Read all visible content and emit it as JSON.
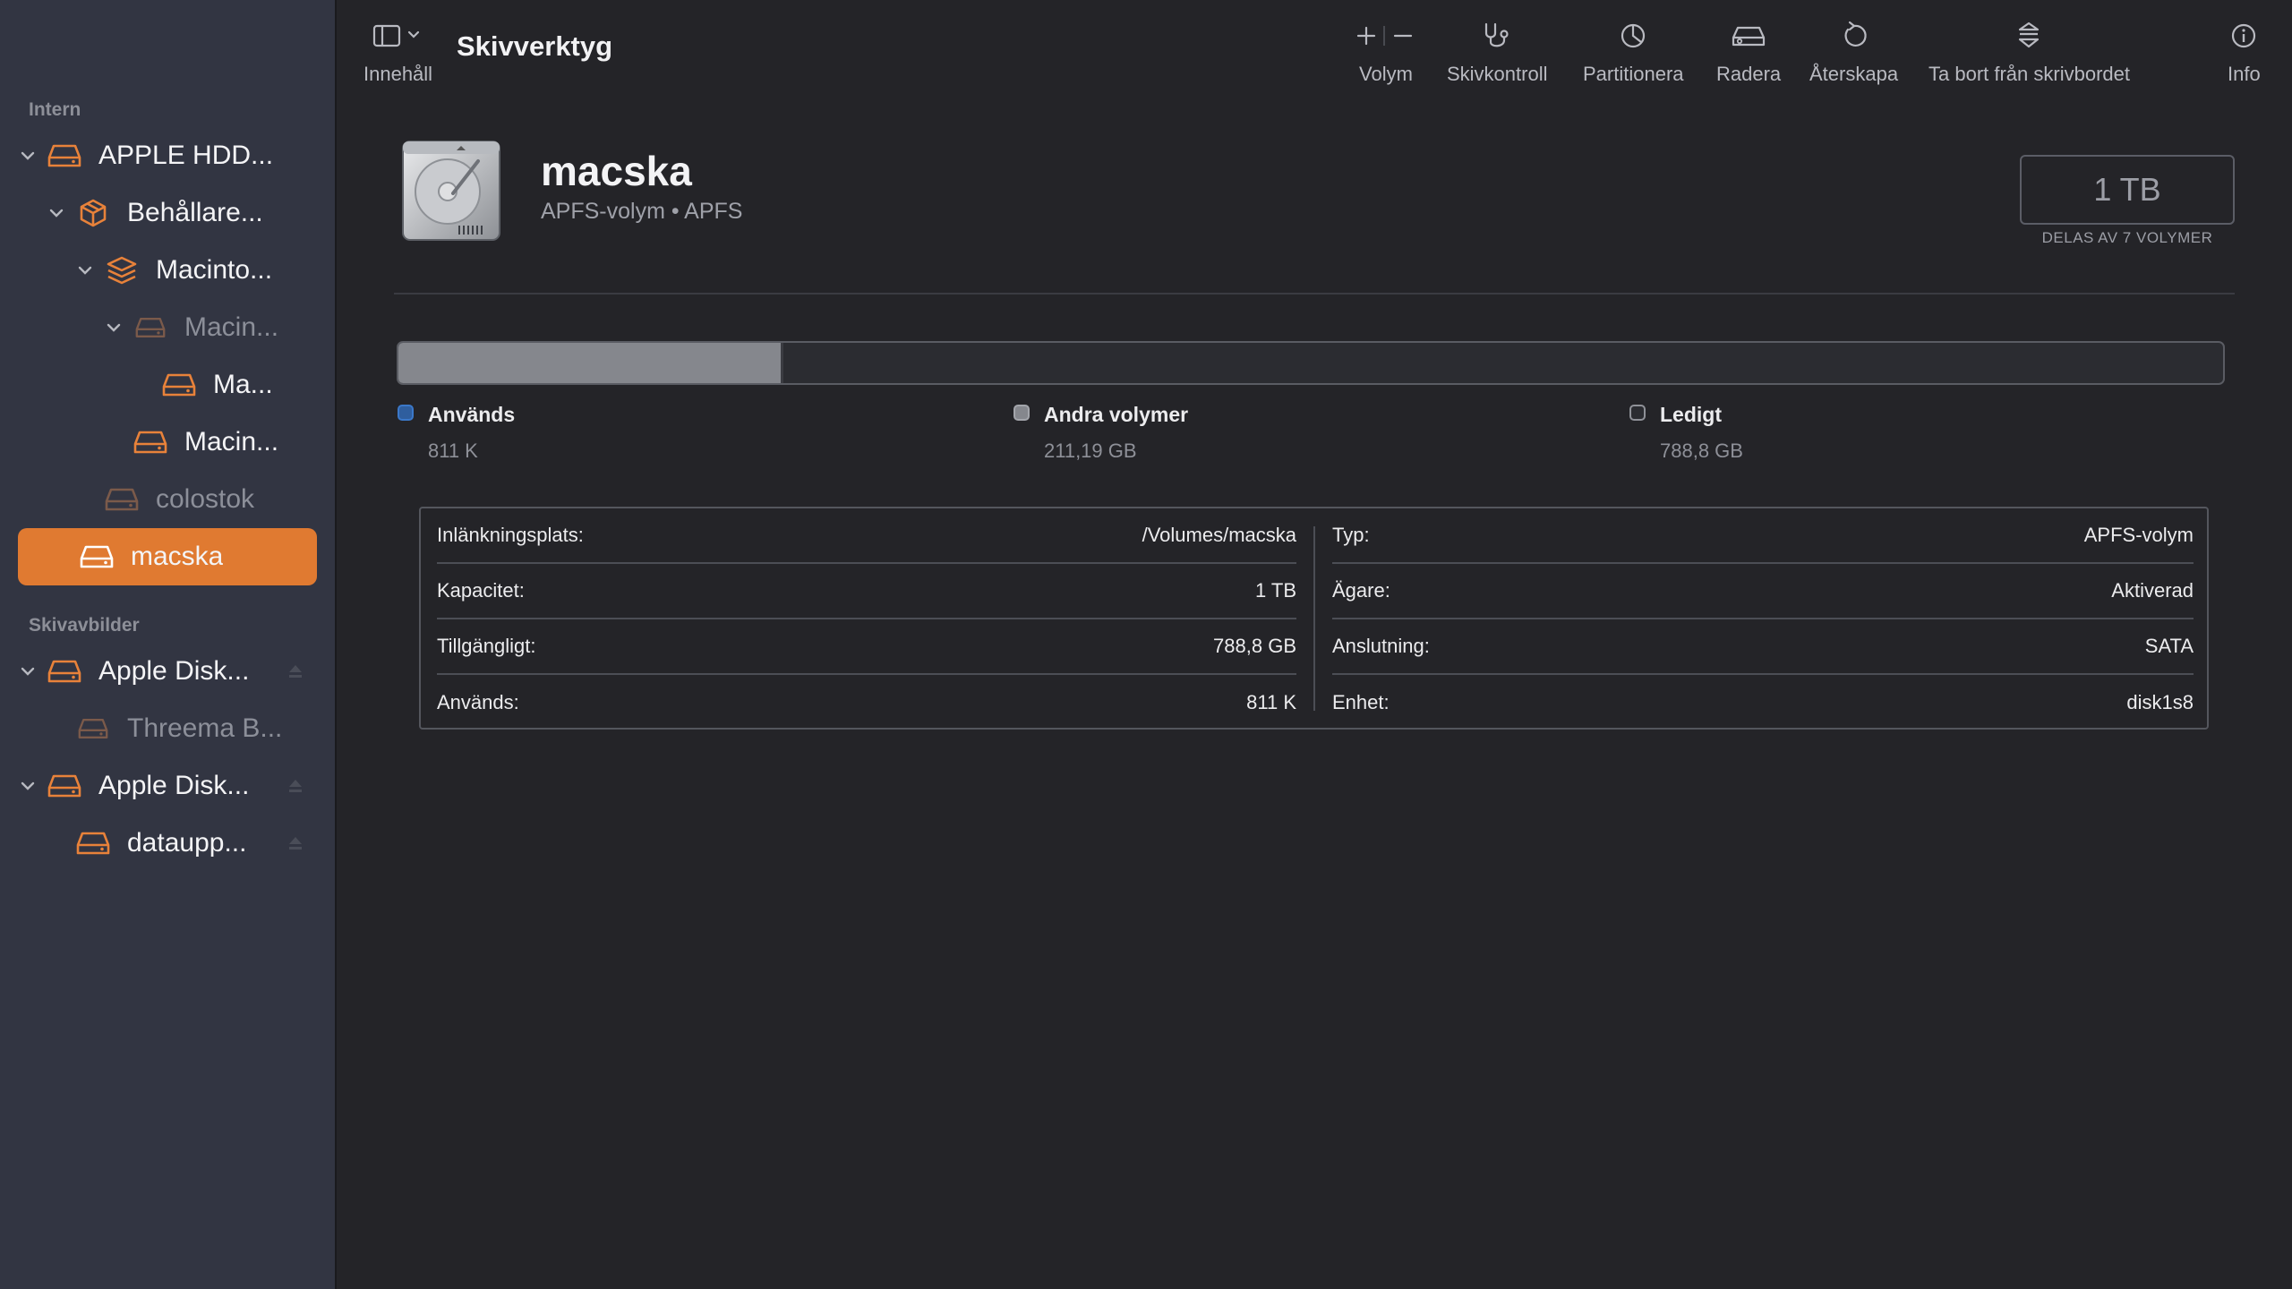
{
  "sidebar": {
    "sections": [
      {
        "label": "Intern"
      },
      {
        "label": "Skivavbilder"
      }
    ],
    "items": [
      {
        "label": "APPLE HDD...",
        "icon": "hard-drive-icon"
      },
      {
        "label": "Behållare...",
        "icon": "container-icon"
      },
      {
        "label": "Macinto...",
        "icon": "volume-group-icon"
      },
      {
        "label": "Macin...",
        "icon": "hard-drive-icon"
      },
      {
        "label": "Ma...",
        "icon": "hard-drive-icon"
      },
      {
        "label": "Macin...",
        "icon": "hard-drive-icon"
      },
      {
        "label": "colostok",
        "icon": "hard-drive-icon"
      },
      {
        "label": "macska",
        "icon": "hard-drive-icon",
        "selected": true
      },
      {
        "label": "Apple Disk...",
        "icon": "hard-drive-icon"
      },
      {
        "label": "Threema B...",
        "icon": "hard-drive-icon"
      },
      {
        "label": "Apple Disk...",
        "icon": "hard-drive-icon"
      },
      {
        "label": "dataupp...",
        "icon": "hard-drive-icon"
      }
    ]
  },
  "toolbar": {
    "sidebar_toggle_label": "Innehåll",
    "title": "Skivverktyg",
    "buttons": {
      "volume": "Volym",
      "first_aid": "Skivkontroll",
      "partition": "Partitionera",
      "erase": "Radera",
      "restore": "Återskapa",
      "unmount": "Ta bort från skrivbordet",
      "info": "Info"
    }
  },
  "volume": {
    "name": "macska",
    "subtitle": "APFS-volym • APFS",
    "capacity": "1 TB",
    "capacity_note": "DELAS AV 7 VOLYMER"
  },
  "usage": {
    "other_fraction": 0.211,
    "legend": [
      {
        "label": "Används",
        "value": "811 K",
        "color": "#3b78c9"
      },
      {
        "label": "Andra volymer",
        "value": "211,19 GB",
        "color": "#85878d"
      },
      {
        "label": "Ledigt",
        "value": "788,8 GB",
        "color": "#2b2c31"
      }
    ]
  },
  "info": {
    "left": [
      {
        "key": "Inlänkningsplats:",
        "value": "/Volumes/macska"
      },
      {
        "key": "Kapacitet:",
        "value": "1 TB"
      },
      {
        "key": "Tillgängligt:",
        "value": "788,8 GB"
      },
      {
        "key": "Används:",
        "value": "811 K"
      }
    ],
    "right": [
      {
        "key": "Typ:",
        "value": "APFS-volym"
      },
      {
        "key": "Ägare:",
        "value": "Aktiverad"
      },
      {
        "key": "Anslutning:",
        "value": "SATA"
      },
      {
        "key": "Enhet:",
        "value": "disk1s8"
      }
    ]
  },
  "colors": {
    "accent": "#e07a31",
    "sidebar_bg": "#323542",
    "content_bg": "#242428"
  }
}
